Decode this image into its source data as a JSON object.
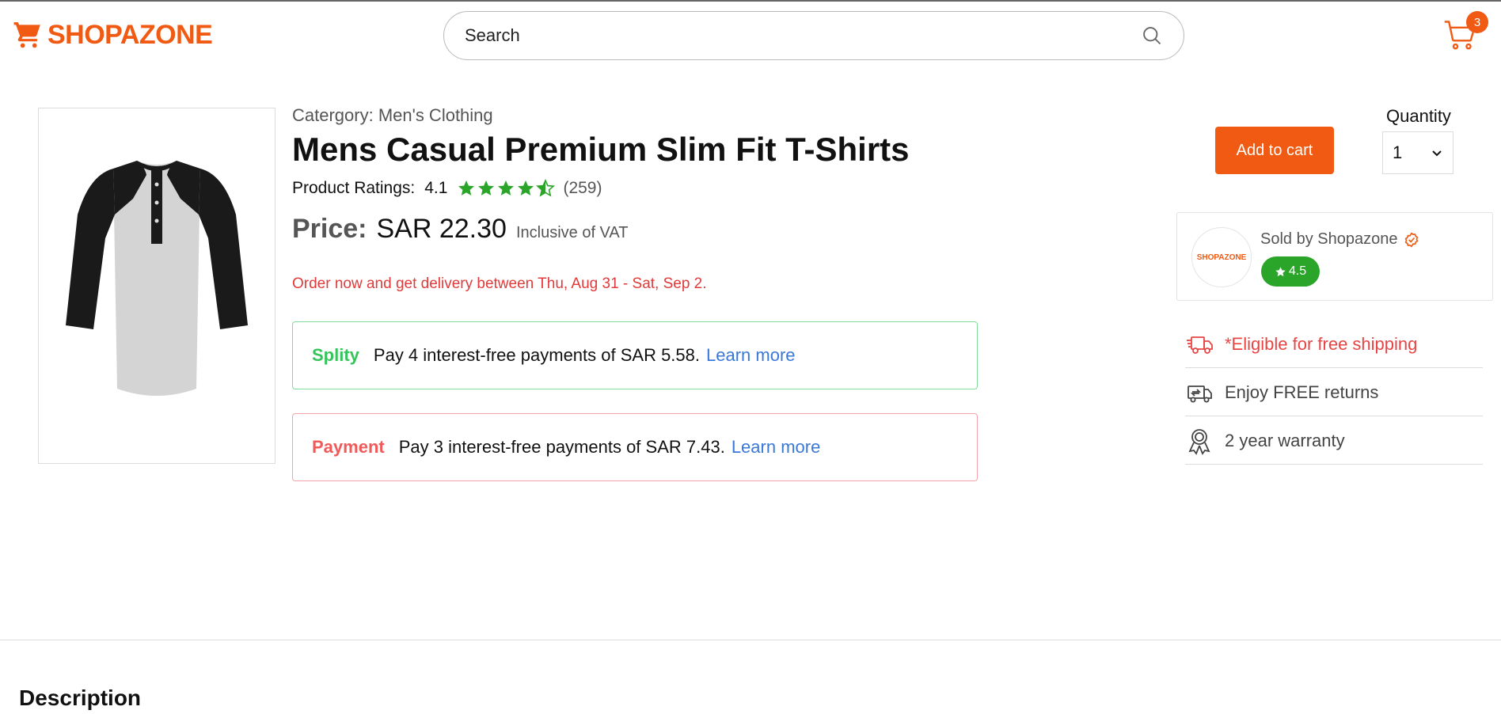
{
  "header": {
    "logo_text": "SHOPAZONE",
    "search_placeholder": "Search",
    "cart_count": "3"
  },
  "product": {
    "category": "Catergory: Men's Clothing",
    "title": "Mens Casual Premium Slim Fit T-Shirts",
    "ratings_label": "Product Ratings:",
    "rating_value": "4.1",
    "rating_stars": 4.5,
    "rating_count": "(259)",
    "price_label": "Price:",
    "price_value": "SAR 22.30",
    "price_note": "Inclusive of VAT",
    "delivery_text": "Order now and get delivery between Thu, Aug 31 - Sat, Sep 2."
  },
  "plans": [
    {
      "brand": "Splity",
      "text": "Pay 4 interest-free payments of SAR 5.58.",
      "link": "Learn more"
    },
    {
      "brand": "Payment",
      "text": "Pay 3 interest-free payments of SAR 7.43.",
      "link": "Learn more"
    }
  ],
  "actions": {
    "add_to_cart": "Add to cart",
    "quantity_label": "Quantity",
    "quantity_value": "1"
  },
  "seller": {
    "logo_text": "SHOPAZONE",
    "name": "Sold by Shopazone",
    "rating": "4.5"
  },
  "features": [
    {
      "icon": "truck-icon",
      "text": "*Eligible for free shipping"
    },
    {
      "icon": "returns-icon",
      "text": "Enjoy FREE returns"
    },
    {
      "icon": "warranty-ribbon-icon",
      "text": "2 year warranty"
    }
  ],
  "description": {
    "title": "Description"
  },
  "colors": {
    "brand": "#f05a12",
    "splity": "#34c45a",
    "payment": "#f05a5a",
    "link": "#3a78d8",
    "star": "#2aa52a",
    "alert": "#e03a3a"
  }
}
